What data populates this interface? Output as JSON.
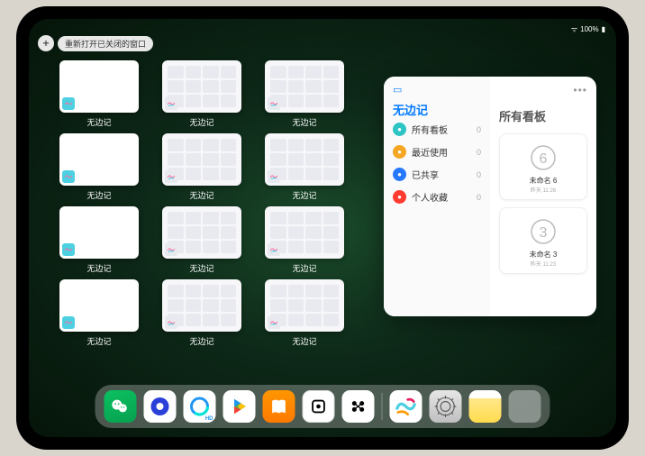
{
  "status": {
    "time": "",
    "battery": "100%"
  },
  "topbar": {
    "plus": "+",
    "reopen_label": "重新打开已关闭的窗口"
  },
  "app_name": "无边记",
  "thumbnails": [
    {
      "label": "无边记",
      "style": "blank"
    },
    {
      "label": "无边记",
      "style": "grid"
    },
    {
      "label": "无边记",
      "style": "grid"
    },
    {
      "label": "无边记",
      "style": "blank"
    },
    {
      "label": "无边记",
      "style": "grid"
    },
    {
      "label": "无边记",
      "style": "grid"
    },
    {
      "label": "无边记",
      "style": "blank"
    },
    {
      "label": "无边记",
      "style": "grid"
    },
    {
      "label": "无边记",
      "style": "grid"
    },
    {
      "label": "无边记",
      "style": "blank"
    },
    {
      "label": "无边记",
      "style": "grid"
    },
    {
      "label": "无边记",
      "style": "grid"
    }
  ],
  "panel": {
    "left_title": "无边记",
    "right_title": "所有看板",
    "items": [
      {
        "label": "所有看板",
        "count": "0",
        "color": "#2ec4c4"
      },
      {
        "label": "最近使用",
        "count": "0",
        "color": "#f5a623"
      },
      {
        "label": "已共享",
        "count": "0",
        "color": "#2678ff"
      },
      {
        "label": "个人收藏",
        "count": "0",
        "color": "#ff3b30"
      }
    ],
    "cards": [
      {
        "name": "未命名 6",
        "sub": "昨天 11:26",
        "glyph": "6"
      },
      {
        "name": "未命名 3",
        "sub": "昨天 11:23",
        "glyph": "3"
      }
    ]
  },
  "dock": {
    "icons": [
      "wechat",
      "quark",
      "qqbrowser",
      "play",
      "books",
      "dice",
      "tiktok",
      "freeform",
      "settings",
      "notes",
      "apps-folder"
    ]
  }
}
